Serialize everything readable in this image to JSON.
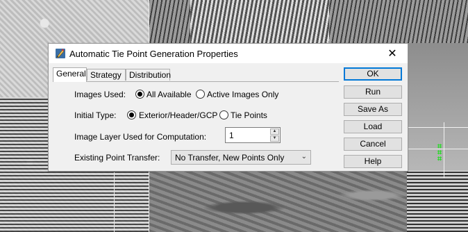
{
  "dialog": {
    "title": "Automatic Tie Point Generation Properties",
    "close_glyph": "✕",
    "app_icon": "pencil-app-icon"
  },
  "tabs": [
    {
      "label": "General",
      "active": true
    },
    {
      "label": "Strategy",
      "active": false
    },
    {
      "label": "Distribution",
      "active": false
    }
  ],
  "general": {
    "images_used": {
      "label": "Images Used:",
      "options": [
        {
          "label": "All Available",
          "checked": true
        },
        {
          "label": "Active Images Only",
          "checked": false
        }
      ]
    },
    "initial_type": {
      "label": "Initial Type:",
      "options": [
        {
          "label": "Exterior/Header/GCP",
          "checked": true
        },
        {
          "label": "Tie Points",
          "checked": false
        }
      ]
    },
    "image_layer": {
      "label": "Image Layer Used for Computation:",
      "value": "1"
    },
    "point_transfer": {
      "label": "Existing Point Transfer:",
      "selected": "No Transfer, New Points Only"
    }
  },
  "buttons": {
    "ok": "OK",
    "run": "Run",
    "save_as": "Save As",
    "load": "Load",
    "cancel": "Cancel",
    "help": "Help"
  },
  "colors": {
    "default_button_border": "#0078d7",
    "dialog_bg": "#f0f0f0",
    "tie_marks": "#22dd22"
  }
}
